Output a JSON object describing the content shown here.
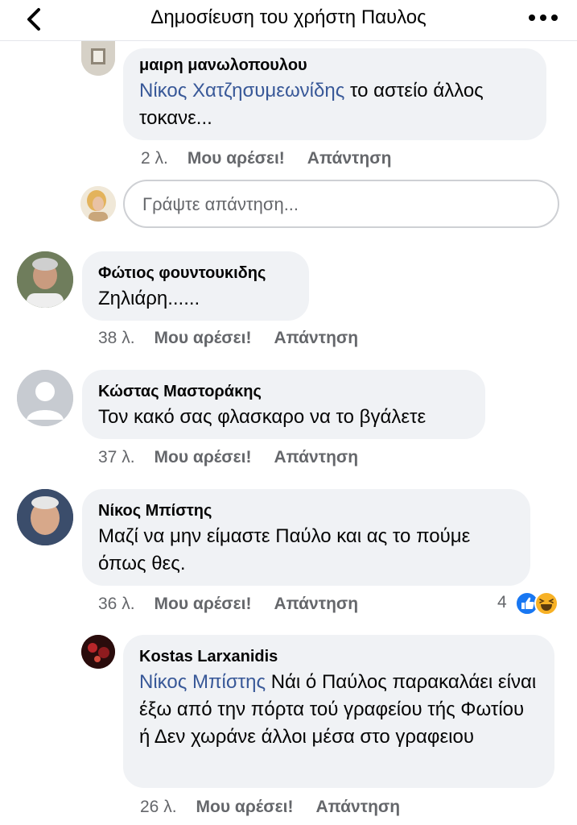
{
  "header": {
    "title": "Δημοσίευση του χρήστη Παυλος"
  },
  "actions": {
    "like": "Μου αρέσει!",
    "reply": "Απάντηση"
  },
  "reply_input": {
    "placeholder": "Γράψτε απάντηση..."
  },
  "comments": [
    {
      "author": "μαιρη μανωλοπουλου",
      "mention": "Νίκος Χατζησυμεωνίδης",
      "text": "το αστείο άλλος τοκανε...",
      "time": "2 λ."
    },
    {
      "author": "Φώτιος φουντουκιδης",
      "text": "Ζηλιάρη......",
      "time": "38 λ."
    },
    {
      "author": "Κώστας Μαστοράκης",
      "text": "Τον κακό σας φλασκαρο να το βγάλετε",
      "time": "37 λ."
    },
    {
      "author": "Νίκος Μπίστης",
      "text": "Μαζί να μην είμαστε Παύλο και ας το πούμε όπως θες.",
      "time": "36 λ.",
      "reactions": {
        "count": "4",
        "types": [
          "like-icon",
          "haha-icon"
        ]
      }
    },
    {
      "author": "Kostas Larxanidis",
      "mention": "Νίκος Μπίστης",
      "text": "Νάι ό Παύλος παρακαλάει είναι έξω από την πόρτα τού γραφείου τής Φωτίου ή Δεν χωράνε άλλοι μέσα στο γραφειου",
      "time": "26 λ."
    }
  ],
  "colors": {
    "bubble": "#f0f2f5",
    "mention": "#385898",
    "meta": "#65676b",
    "like_blue": "#1877f2",
    "haha_yellow": "#f7b125"
  }
}
